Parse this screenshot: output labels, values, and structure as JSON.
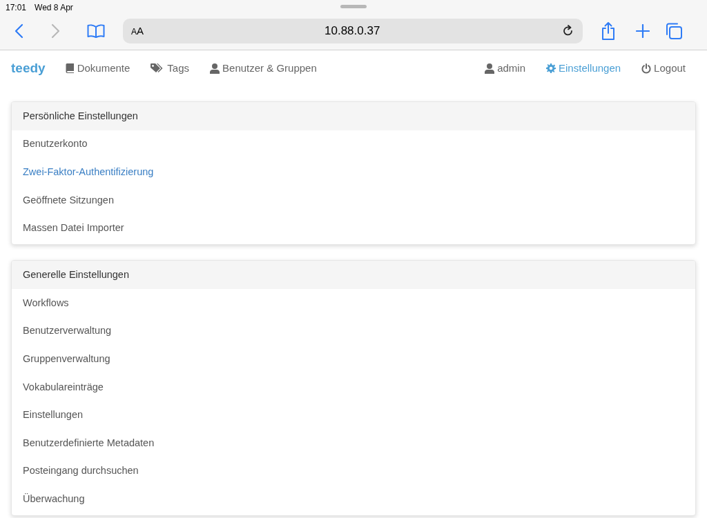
{
  "status_bar": {
    "time": "17:01",
    "date": "Wed 8 Apr"
  },
  "browser": {
    "back_enabled": true,
    "forward_enabled": false,
    "text_size": "AA",
    "address": "10.88.0.37"
  },
  "navbar": {
    "brand": "teedy",
    "left": [
      {
        "label": "Dokumente",
        "selected": false
      },
      {
        "label": "Tags",
        "selected": false
      },
      {
        "label": "Benutzer & Gruppen",
        "selected": false
      }
    ],
    "right": [
      {
        "label": "admin",
        "selected": false
      },
      {
        "label": "Einstellungen",
        "selected": true
      },
      {
        "label": "Logout",
        "selected": false
      }
    ]
  },
  "panels": [
    {
      "title": "Persönliche Einstellungen",
      "items": [
        {
          "label": "Benutzerkonto",
          "selected": false
        },
        {
          "label": "Zwei-Faktor-Authentifizierung",
          "selected": true
        },
        {
          "label": "Geöffnete Sitzungen",
          "selected": false
        },
        {
          "label": "Massen Datei Importer",
          "selected": false
        }
      ]
    },
    {
      "title": "Generelle Einstellungen",
      "items": [
        {
          "label": "Workflows",
          "selected": false
        },
        {
          "label": "Benutzerverwaltung",
          "selected": false
        },
        {
          "label": "Gruppenverwaltung",
          "selected": false
        },
        {
          "label": "Vokabulareinträge",
          "selected": false
        },
        {
          "label": "Einstellungen",
          "selected": false
        },
        {
          "label": "Benutzerdefinierte Metadaten",
          "selected": false
        },
        {
          "label": "Posteingang durchsuchen",
          "selected": false
        },
        {
          "label": "Überwachung",
          "selected": false
        }
      ]
    }
  ]
}
